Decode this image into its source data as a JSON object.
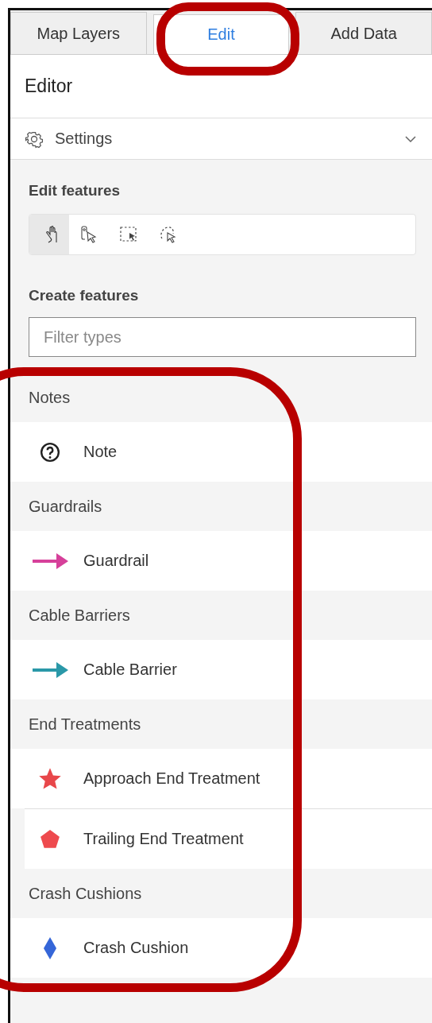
{
  "tabs": [
    {
      "label": "Map Layers",
      "selected": false
    },
    {
      "label": "Edit",
      "selected": true
    },
    {
      "label": "Add Data",
      "selected": false
    }
  ],
  "editor": {
    "title": "Editor"
  },
  "settings": {
    "label": "Settings",
    "expanded": false
  },
  "edit_features": {
    "title": "Edit features",
    "tools": [
      {
        "kind": "pan",
        "selected": true
      },
      {
        "kind": "select",
        "selected": false
      },
      {
        "kind": "rectangle",
        "selected": false
      },
      {
        "kind": "lasso",
        "selected": false
      }
    ]
  },
  "create_features": {
    "title": "Create features",
    "filter": {
      "placeholder": "Filter types"
    },
    "groups": [
      {
        "name": "Notes",
        "items": [
          {
            "label": "Note",
            "kind": "note",
            "color": "#222222"
          }
        ]
      },
      {
        "name": "Guardrails",
        "items": [
          {
            "label": "Guardrail",
            "kind": "arrow",
            "color": "#d6409a"
          }
        ]
      },
      {
        "name": "Cable Barriers",
        "items": [
          {
            "label": "Cable Barrier",
            "kind": "arrow",
            "color": "#2a98a8"
          }
        ]
      },
      {
        "name": "End Treatments",
        "items": [
          {
            "label": "Approach End Treatment",
            "kind": "star",
            "color": "#e8474a"
          },
          {
            "label": "Trailing End Treatment",
            "kind": "pentagon",
            "color": "#ee4a4e"
          }
        ]
      },
      {
        "name": "Crash Cushions",
        "items": [
          {
            "label": "Crash Cushion",
            "kind": "diamond",
            "color": "#3566d8"
          }
        ]
      }
    ]
  }
}
